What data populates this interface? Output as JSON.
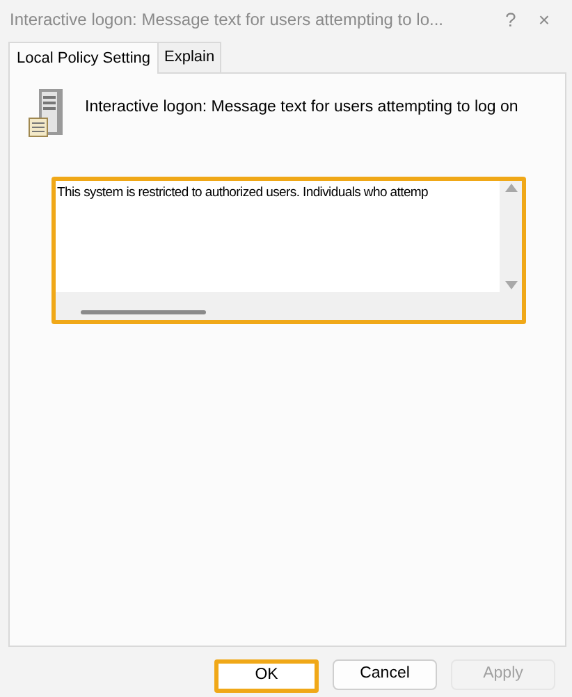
{
  "window": {
    "title": "Interactive logon: Message text for users attempting to lo...",
    "help": "?",
    "close": "×"
  },
  "tabs": [
    {
      "label": "Local Policy Setting",
      "selected": true
    },
    {
      "label": "Explain",
      "selected": false
    }
  ],
  "policy": {
    "label": "Interactive logon: Message text for users attempting to log on"
  },
  "message_box": {
    "value": "This system is restricted to authorized users. Individuals who attemp",
    "highlighted": true
  },
  "buttons": [
    {
      "label": "OK",
      "highlighted": true,
      "disabled": false
    },
    {
      "label": "Cancel",
      "highlighted": false,
      "disabled": false
    },
    {
      "label": "Apply",
      "highlighted": false,
      "disabled": true
    }
  ]
}
